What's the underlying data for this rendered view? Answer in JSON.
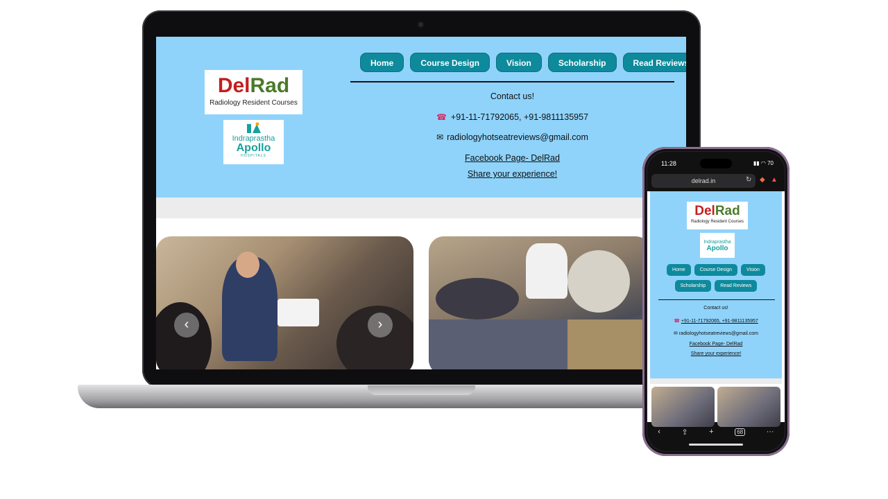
{
  "site": {
    "logo": {
      "del": "Del",
      "rad": "Rad",
      "subtitle": "Radiology Resident Courses"
    },
    "partner_logo": {
      "line1": "Indraprastha",
      "line2": "Apollo",
      "line3": "HOSPITALS"
    },
    "nav": [
      "Home",
      "Course Design",
      "Vision",
      "Scholarship",
      "Read Reviews"
    ],
    "contact": {
      "heading": "Contact us!",
      "phone": "+91-11-71792065, +91-9811135957",
      "email": "radiologyhotseatreviews@gmail.com",
      "facebook": "Facebook Page- DelRad",
      "share": "Share your experience!"
    },
    "carousel": {
      "prev": "‹",
      "next": "›"
    }
  },
  "phone": {
    "time": "11:28",
    "status_icons": "▮▮ ◠ 70",
    "url": "delrad.in",
    "toolbar": [
      "‹",
      "⇪",
      "+",
      "68",
      "···"
    ]
  },
  "colors": {
    "header_bg": "#8fd3fb",
    "button_bg": "#0e8a9c",
    "logo_red": "#c41e1e",
    "logo_green": "#4a7a2a",
    "apollo_teal": "#17a0a0"
  }
}
